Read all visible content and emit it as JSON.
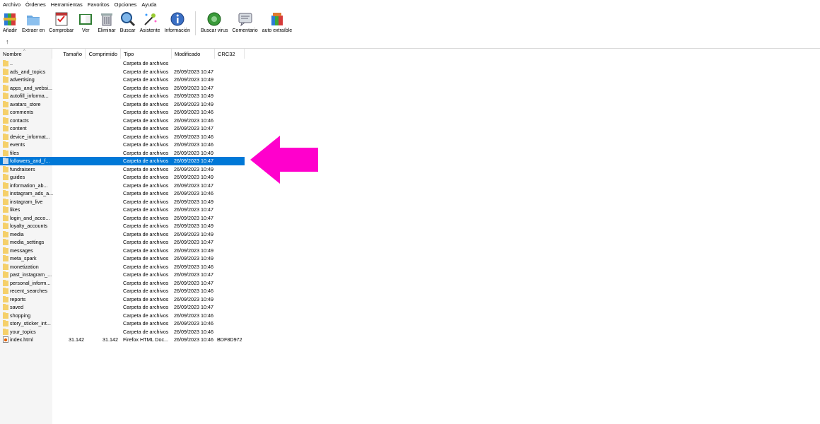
{
  "menu": [
    "Archivo",
    "Órdenes",
    "Herramientas",
    "Favoritos",
    "Opciones",
    "Ayuda"
  ],
  "toolbar": [
    {
      "label": "Añadir",
      "icon": "add-archive-icon"
    },
    {
      "label": "Extraer en",
      "icon": "extract-folder-icon"
    },
    {
      "label": "Comprobar",
      "icon": "test-archive-icon"
    },
    {
      "label": "Ver",
      "icon": "view-book-icon"
    },
    {
      "label": "Eliminar",
      "icon": "trash-icon"
    },
    {
      "label": "Buscar",
      "icon": "magnifier-icon"
    },
    {
      "label": "Asistente",
      "icon": "wizard-wand-icon"
    },
    {
      "label": "Información",
      "icon": "info-icon"
    },
    {
      "label": "Buscar virus",
      "icon": "virus-scan-icon"
    },
    {
      "label": "Comentario",
      "icon": "comment-icon"
    },
    {
      "label": "auto extraíble",
      "icon": "sfx-archive-icon"
    }
  ],
  "path_up_symbol": "↑",
  "columns": {
    "name": "Nombre",
    "size": "Tamaño",
    "packed": "Comprimido",
    "type": "Tipo",
    "modified": "Modificado",
    "crc": "CRC32"
  },
  "sort_indicator": "^",
  "colors": {
    "selection": "#0078d7",
    "arrow": "#ff00cc",
    "folder": "#f5d06a"
  },
  "files": [
    {
      "name": "..",
      "size": "",
      "packed": "",
      "type": "Carpeta de archivos",
      "modified": "",
      "crc": "",
      "kind": "folder"
    },
    {
      "name": "ads_and_topics",
      "size": "",
      "packed": "",
      "type": "Carpeta de archivos",
      "modified": "26/09/2023 10:47",
      "crc": "",
      "kind": "folder"
    },
    {
      "name": "advertising",
      "size": "",
      "packed": "",
      "type": "Carpeta de archivos",
      "modified": "26/09/2023 10:49",
      "crc": "",
      "kind": "folder"
    },
    {
      "name": "apps_and_websi...",
      "size": "",
      "packed": "",
      "type": "Carpeta de archivos",
      "modified": "26/09/2023 10:47",
      "crc": "",
      "kind": "folder"
    },
    {
      "name": "autofill_informa...",
      "size": "",
      "packed": "",
      "type": "Carpeta de archivos",
      "modified": "26/09/2023 10:49",
      "crc": "",
      "kind": "folder"
    },
    {
      "name": "avatars_store",
      "size": "",
      "packed": "",
      "type": "Carpeta de archivos",
      "modified": "26/09/2023 10:49",
      "crc": "",
      "kind": "folder"
    },
    {
      "name": "comments",
      "size": "",
      "packed": "",
      "type": "Carpeta de archivos",
      "modified": "26/09/2023 10:46",
      "crc": "",
      "kind": "folder"
    },
    {
      "name": "contacts",
      "size": "",
      "packed": "",
      "type": "Carpeta de archivos",
      "modified": "26/09/2023 10:46",
      "crc": "",
      "kind": "folder"
    },
    {
      "name": "content",
      "size": "",
      "packed": "",
      "type": "Carpeta de archivos",
      "modified": "26/09/2023 10:47",
      "crc": "",
      "kind": "folder"
    },
    {
      "name": "device_informat...",
      "size": "",
      "packed": "",
      "type": "Carpeta de archivos",
      "modified": "26/09/2023 10:46",
      "crc": "",
      "kind": "folder"
    },
    {
      "name": "events",
      "size": "",
      "packed": "",
      "type": "Carpeta de archivos",
      "modified": "26/09/2023 10:46",
      "crc": "",
      "kind": "folder"
    },
    {
      "name": "files",
      "size": "",
      "packed": "",
      "type": "Carpeta de archivos",
      "modified": "26/09/2023 10:49",
      "crc": "",
      "kind": "folder"
    },
    {
      "name": "followers_and_f...",
      "size": "",
      "packed": "",
      "type": "Carpeta de archivos",
      "modified": "26/09/2023 10:47",
      "crc": "",
      "kind": "folder",
      "selected": true
    },
    {
      "name": "fundraisers",
      "size": "",
      "packed": "",
      "type": "Carpeta de archivos",
      "modified": "26/09/2023 10:49",
      "crc": "",
      "kind": "folder"
    },
    {
      "name": "guides",
      "size": "",
      "packed": "",
      "type": "Carpeta de archivos",
      "modified": "26/09/2023 10:49",
      "crc": "",
      "kind": "folder"
    },
    {
      "name": "information_ab...",
      "size": "",
      "packed": "",
      "type": "Carpeta de archivos",
      "modified": "26/09/2023 10:47",
      "crc": "",
      "kind": "folder"
    },
    {
      "name": "instagram_ads_a...",
      "size": "",
      "packed": "",
      "type": "Carpeta de archivos",
      "modified": "26/09/2023 10:46",
      "crc": "",
      "kind": "folder"
    },
    {
      "name": "instagram_live",
      "size": "",
      "packed": "",
      "type": "Carpeta de archivos",
      "modified": "26/09/2023 10:49",
      "crc": "",
      "kind": "folder"
    },
    {
      "name": "likes",
      "size": "",
      "packed": "",
      "type": "Carpeta de archivos",
      "modified": "26/09/2023 10:47",
      "crc": "",
      "kind": "folder"
    },
    {
      "name": "login_and_acco...",
      "size": "",
      "packed": "",
      "type": "Carpeta de archivos",
      "modified": "26/09/2023 10:47",
      "crc": "",
      "kind": "folder"
    },
    {
      "name": "loyalty_accounts",
      "size": "",
      "packed": "",
      "type": "Carpeta de archivos",
      "modified": "26/09/2023 10:49",
      "crc": "",
      "kind": "folder"
    },
    {
      "name": "media",
      "size": "",
      "packed": "",
      "type": "Carpeta de archivos",
      "modified": "26/09/2023 10:49",
      "crc": "",
      "kind": "folder"
    },
    {
      "name": "media_settings",
      "size": "",
      "packed": "",
      "type": "Carpeta de archivos",
      "modified": "26/09/2023 10:47",
      "crc": "",
      "kind": "folder"
    },
    {
      "name": "messages",
      "size": "",
      "packed": "",
      "type": "Carpeta de archivos",
      "modified": "26/09/2023 10:49",
      "crc": "",
      "kind": "folder"
    },
    {
      "name": "meta_spark",
      "size": "",
      "packed": "",
      "type": "Carpeta de archivos",
      "modified": "26/09/2023 10:49",
      "crc": "",
      "kind": "folder"
    },
    {
      "name": "monetization",
      "size": "",
      "packed": "",
      "type": "Carpeta de archivos",
      "modified": "26/09/2023 10:46",
      "crc": "",
      "kind": "folder"
    },
    {
      "name": "past_instagram_...",
      "size": "",
      "packed": "",
      "type": "Carpeta de archivos",
      "modified": "26/09/2023 10:47",
      "crc": "",
      "kind": "folder"
    },
    {
      "name": "personal_inform...",
      "size": "",
      "packed": "",
      "type": "Carpeta de archivos",
      "modified": "26/09/2023 10:47",
      "crc": "",
      "kind": "folder"
    },
    {
      "name": "recent_searches",
      "size": "",
      "packed": "",
      "type": "Carpeta de archivos",
      "modified": "26/09/2023 10:46",
      "crc": "",
      "kind": "folder"
    },
    {
      "name": "reports",
      "size": "",
      "packed": "",
      "type": "Carpeta de archivos",
      "modified": "26/09/2023 10:49",
      "crc": "",
      "kind": "folder"
    },
    {
      "name": "saved",
      "size": "",
      "packed": "",
      "type": "Carpeta de archivos",
      "modified": "26/09/2023 10:47",
      "crc": "",
      "kind": "folder"
    },
    {
      "name": "shopping",
      "size": "",
      "packed": "",
      "type": "Carpeta de archivos",
      "modified": "26/09/2023 10:46",
      "crc": "",
      "kind": "folder"
    },
    {
      "name": "story_sticker_int...",
      "size": "",
      "packed": "",
      "type": "Carpeta de archivos",
      "modified": "26/09/2023 10:46",
      "crc": "",
      "kind": "folder"
    },
    {
      "name": "your_topics",
      "size": "",
      "packed": "",
      "type": "Carpeta de archivos",
      "modified": "26/09/2023 10:46",
      "crc": "",
      "kind": "folder"
    },
    {
      "name": "index.html",
      "size": "31.142",
      "packed": "31.142",
      "type": "Firefox HTML Doc...",
      "modified": "26/09/2023 10:46",
      "crc": "BDF8D972",
      "kind": "html"
    }
  ]
}
